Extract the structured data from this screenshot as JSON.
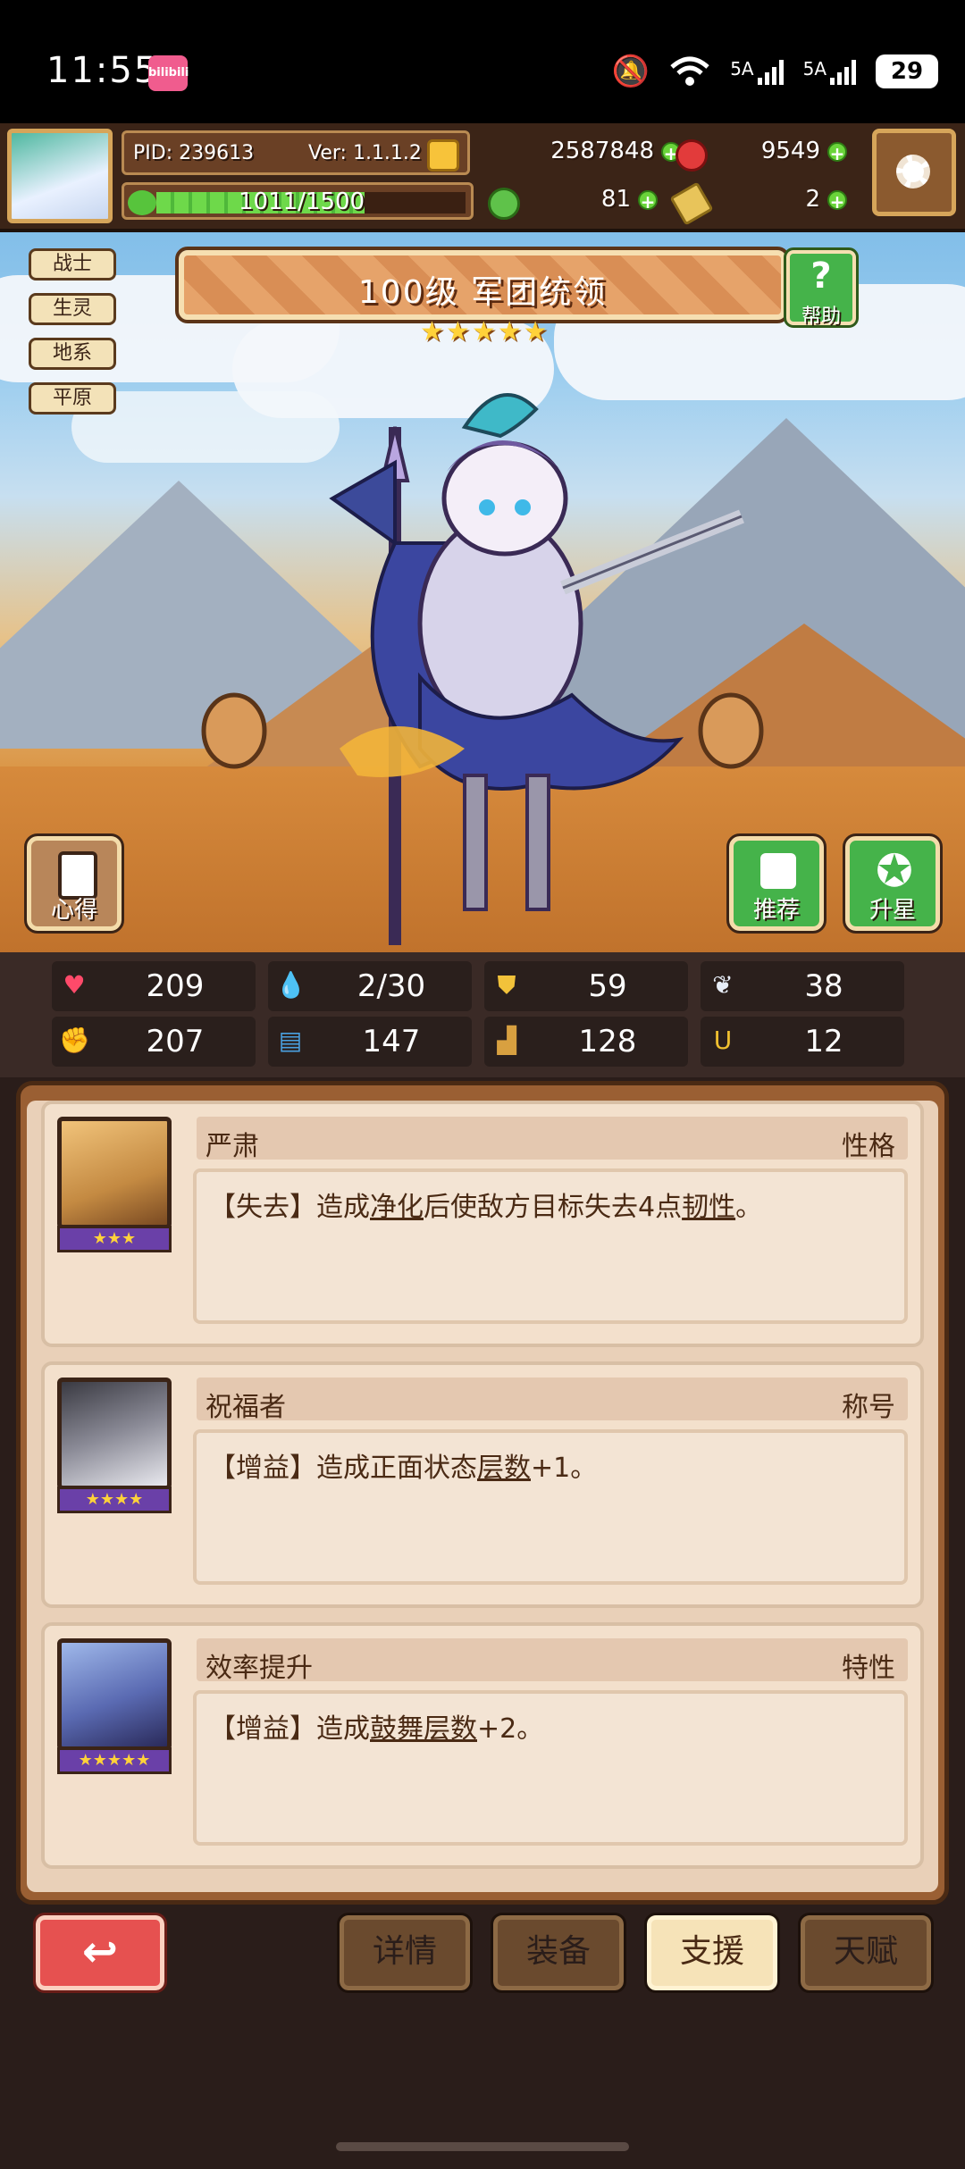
{
  "status_bar": {
    "time": "11:55",
    "app_badge": "bilibili",
    "signal1": "5A",
    "signal2": "5A",
    "battery": "29"
  },
  "player": {
    "pid_label": "PID: 239613",
    "version_label": "Ver: 1.1.1.2",
    "gold": "2587848",
    "gems": "9549",
    "xp": "1011/1500",
    "xp_progress": 0.674,
    "clover": "81",
    "scroll": "2"
  },
  "hero": {
    "tags": [
      "战士",
      "生灵",
      "地系",
      "平原"
    ],
    "title": "100级 军团统领",
    "stars": 5,
    "help_label": "帮助",
    "notes_label": "心得",
    "recommend_label": "推荐",
    "upgrade_label": "升星"
  },
  "stats": [
    {
      "icon": "heart-icon",
      "value": "209"
    },
    {
      "icon": "water-drop-icon",
      "value": "2/30"
    },
    {
      "icon": "shield-icon",
      "value": "59"
    },
    {
      "icon": "wing-icon",
      "value": "38"
    },
    {
      "icon": "fist-icon",
      "value": "207"
    },
    {
      "icon": "book-icon",
      "value": "147"
    },
    {
      "icon": "boot-icon",
      "value": "128"
    },
    {
      "icon": "horseshoe-icon",
      "value": "12"
    }
  ],
  "cards": [
    {
      "name": "严肃",
      "type": "性格",
      "stars": "★★★",
      "desc_prefix": "【失去】造成",
      "desc_link1": "净化",
      "desc_mid": "后使敌方目标失去4点",
      "desc_link2": "韧性",
      "desc_suffix": "。"
    },
    {
      "name": "祝福者",
      "type": "称号",
      "stars": "★★★★",
      "desc_prefix": "【增益】造成正面状态",
      "desc_link1": "层数",
      "desc_mid": "+1。",
      "desc_link2": "",
      "desc_suffix": ""
    },
    {
      "name": "效率提升",
      "type": "特性",
      "stars": "★★★★★",
      "desc_prefix": "【增益】造成",
      "desc_link1": "鼓舞层数",
      "desc_mid": "+2。",
      "desc_link2": "",
      "desc_suffix": ""
    }
  ],
  "nav": {
    "tabs": [
      "详情",
      "装备",
      "支援",
      "天赋"
    ],
    "active": "支援"
  },
  "colors": {
    "accent_red": "#e65150",
    "accent_green": "#45b34a",
    "gold": "#ffd23a"
  }
}
